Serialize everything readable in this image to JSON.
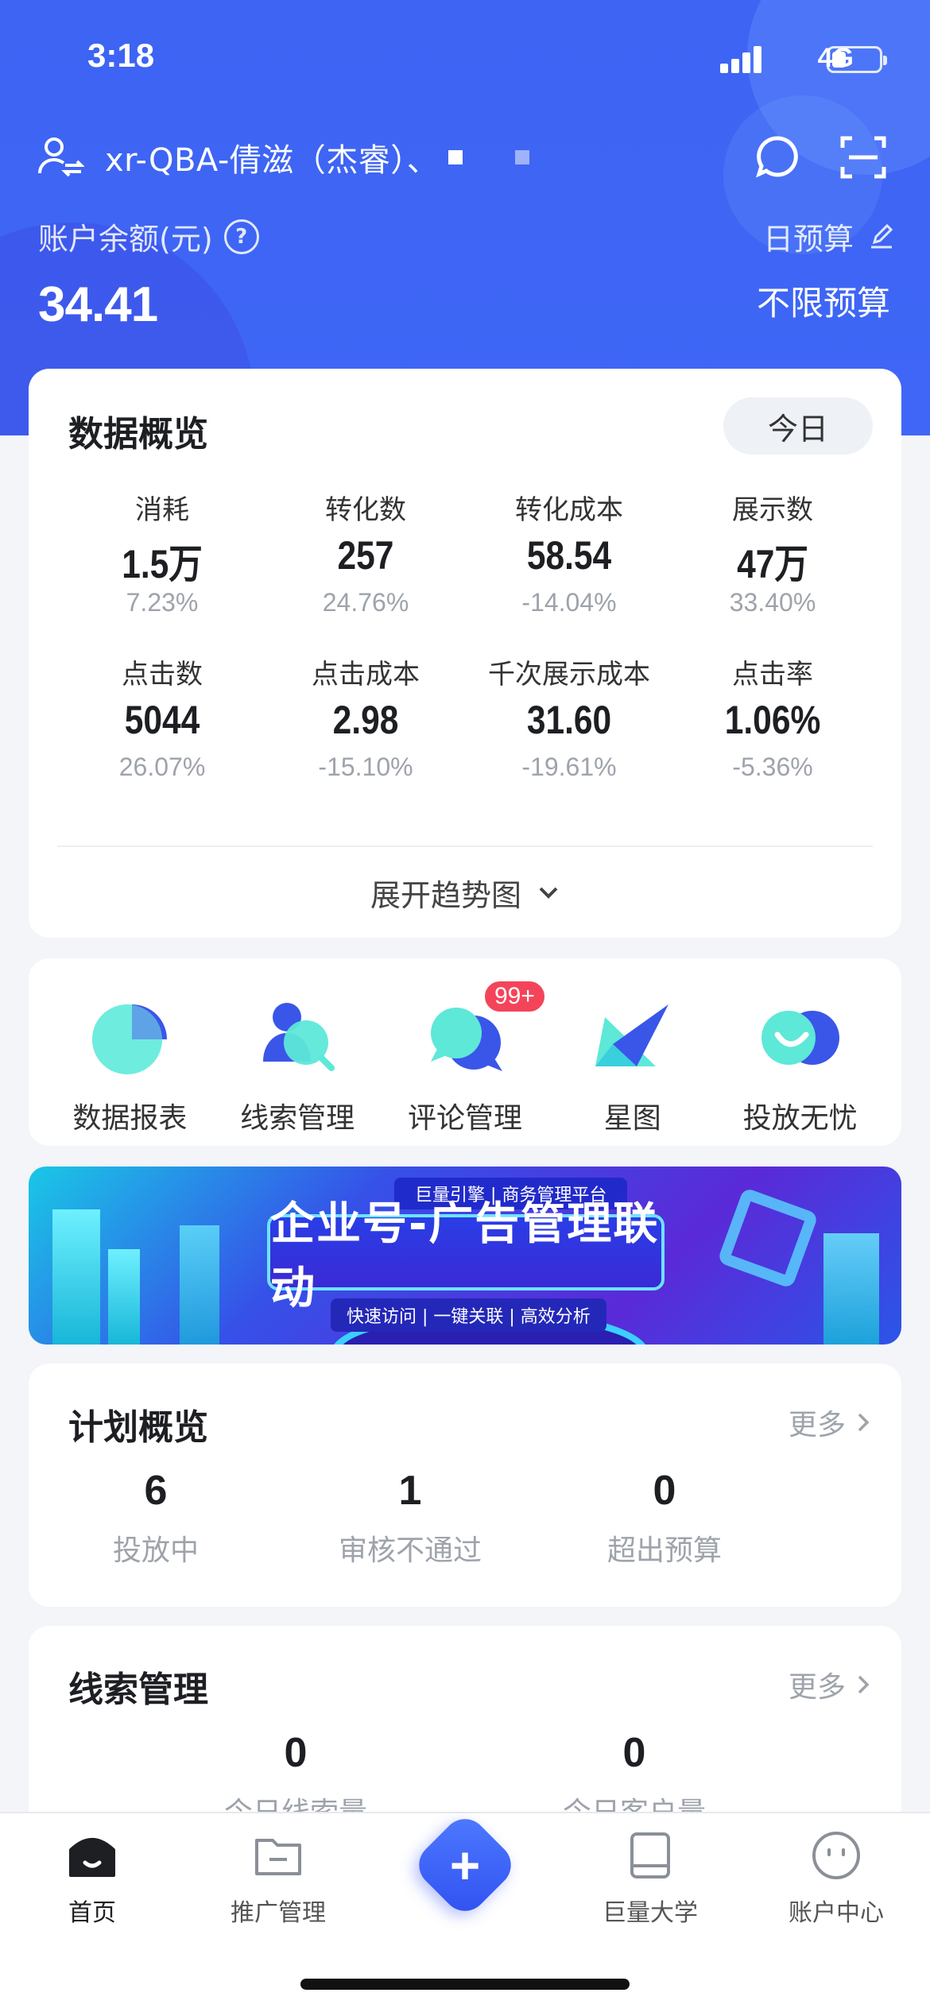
{
  "status": {
    "time": "3:18",
    "network": "4G",
    "battery_level": 0.3
  },
  "header": {
    "account_name": "xr-QBA-倩滋（杰睿）、",
    "balance_label": "账户余额(元)",
    "balance": "34.41",
    "budget_label": "日预算",
    "budget_value": "不限预算"
  },
  "overview": {
    "title": "数据概览",
    "period": "今日",
    "metrics": [
      {
        "label": "消耗",
        "value": "1.5万",
        "change": "7.23%"
      },
      {
        "label": "转化数",
        "value": "257",
        "change": "24.76%"
      },
      {
        "label": "转化成本",
        "value": "58.54",
        "change": "-14.04%"
      },
      {
        "label": "展示数",
        "value": "47万",
        "change": "33.40%"
      },
      {
        "label": "点击数",
        "value": "5044",
        "change": "26.07%"
      },
      {
        "label": "点击成本",
        "value": "2.98",
        "change": "-15.10%"
      },
      {
        "label": "千次展示成本",
        "value": "31.60",
        "change": "-19.61%"
      },
      {
        "label": "点击率",
        "value": "1.06%",
        "change": "-5.36%"
      }
    ],
    "expand_label": "展开趋势图"
  },
  "tools": [
    {
      "label": "数据报表",
      "icon": "pie-chart-icon"
    },
    {
      "label": "线索管理",
      "icon": "leads-people-icon"
    },
    {
      "label": "评论管理",
      "icon": "comment-bubbles-icon",
      "badge": "99+"
    },
    {
      "label": "星图",
      "icon": "star-map-icon"
    },
    {
      "label": "投放无忧",
      "icon": "smile-circles-icon"
    }
  ],
  "banner": {
    "platform": "巨量引擎 | 商务管理平台",
    "headline": "企业号-广告管理联动",
    "tags": "快速访问 | 一键关联 | 高效分析"
  },
  "plan": {
    "title": "计划概览",
    "more": "更多",
    "stats": [
      {
        "num": "6",
        "label": "投放中"
      },
      {
        "num": "1",
        "label": "审核不通过"
      },
      {
        "num": "0",
        "label": "超出预算"
      }
    ]
  },
  "leads": {
    "title": "线索管理",
    "more": "更多",
    "stats": [
      {
        "num": "0",
        "label": "今日线索量"
      },
      {
        "num": "0",
        "label": "今日客户量"
      }
    ]
  },
  "tabbar": [
    {
      "label": "首页",
      "icon": "home-icon"
    },
    {
      "label": "推广管理",
      "icon": "folder-icon"
    },
    {
      "label": "巨量大学",
      "icon": "book-icon"
    },
    {
      "label": "账户中心",
      "icon": "user-face-icon"
    }
  ],
  "colors": {
    "primary": "#3d64f3",
    "accent_red": "#f4445a",
    "muted": "#9ea3ab"
  }
}
